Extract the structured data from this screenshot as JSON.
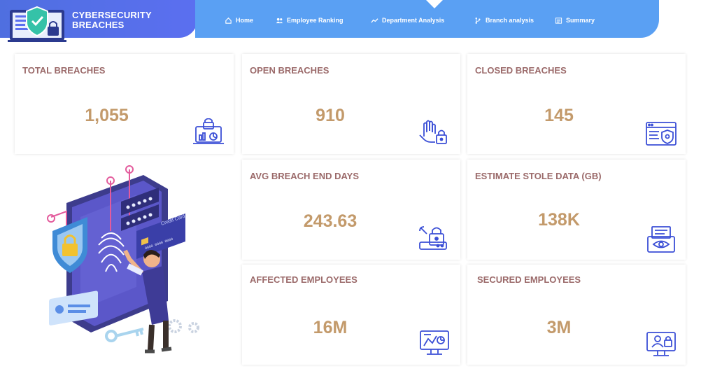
{
  "header": {
    "title_line1": "CYBERSECURITY",
    "title_line2": "BREACHES"
  },
  "nav": [
    {
      "label": "Home",
      "icon": "home-icon"
    },
    {
      "label": "Employee Ranking",
      "icon": "users-icon"
    },
    {
      "label": "Department Analysis",
      "icon": "trend-icon"
    },
    {
      "label": "Branch analysis",
      "icon": "branch-icon"
    },
    {
      "label": "Summary",
      "icon": "summary-icon"
    }
  ],
  "cards": {
    "total": {
      "title": "TOTAL BREACHES",
      "value": "1,055",
      "icon": "laptop-lock-icon"
    },
    "open": {
      "title": "OPEN BREACHES",
      "value": "910",
      "icon": "hand-lock-icon"
    },
    "closed": {
      "title": "CLOSED BREACHES",
      "value": "145",
      "icon": "browser-shield-icon"
    },
    "avg": {
      "title": "AVG BREACH END DAYS",
      "value": "243.63",
      "icon": "lock-tools-icon"
    },
    "stole": {
      "title": "ESTIMATE STOLE DATA (GB)",
      "value": "138K",
      "icon": "printer-eye-icon"
    },
    "affected": {
      "title": "AFFECTED EMPLOYEES",
      "value": "16M",
      "icon": "monitor-chart-icon"
    },
    "secured": {
      "title": "SECURED EMPLOYEES",
      "value": "3M",
      "icon": "monitor-hacker-icon"
    }
  },
  "illustration": {
    "card_label": "Credit Card"
  },
  "colors": {
    "header_left": "#5b6ff0",
    "navbar": "#5aa0f3",
    "card_title": "#9b6a6a",
    "card_value": "#c39a6b",
    "icon_stroke": "#3b4fd6"
  }
}
